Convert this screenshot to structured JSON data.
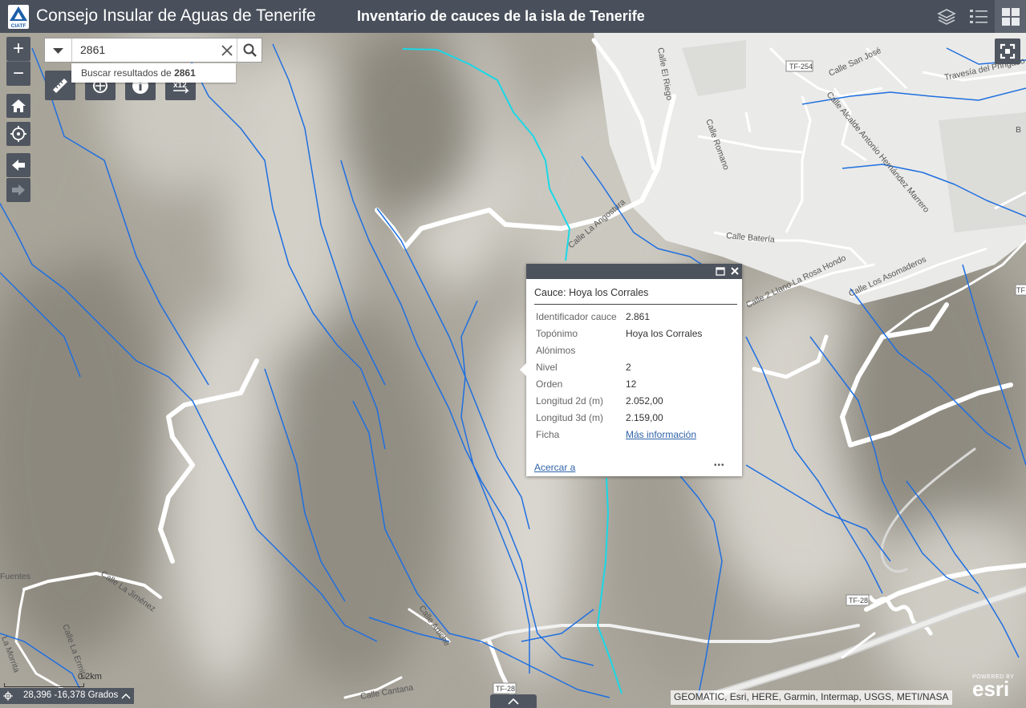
{
  "header": {
    "app_title": "Consejo Insular de Aguas de Tenerife",
    "subtitle": "Inventario de cauces de la isla de Tenerife",
    "logo_text": "CIATF",
    "buttons": [
      "layers-icon",
      "legend-icon",
      "basemap-gallery-icon"
    ]
  },
  "search": {
    "value": "2861",
    "suggestion_prefix": "Buscar resultados de ",
    "suggestion_term": "2861"
  },
  "controls": {
    "zoom_in": "+",
    "zoom_out": "−",
    "measure_tool": "ruler-icon",
    "draw_tool": "draw-icon",
    "info_tool": "info-icon",
    "coordinate_tool": "xy-icon"
  },
  "popup": {
    "title": "Cauce: Hoya los Corrales",
    "fields": [
      {
        "label": "Identificador cauce",
        "value": "2.861"
      },
      {
        "label": "Topónimo",
        "value": "Hoya los Corrales"
      },
      {
        "label": "Alónimos",
        "value": ""
      },
      {
        "label": "Nivel",
        "value": "2"
      },
      {
        "label": "Orden",
        "value": "12"
      },
      {
        "label": "Longitud 2d (m)",
        "value": "2.052,00"
      },
      {
        "label": "Longitud 3d (m)",
        "value": "2.159,00"
      },
      {
        "label": "Ficha",
        "value": "Más información"
      }
    ],
    "zoom_link": "Acercar a",
    "more": "•••"
  },
  "map": {
    "street_labels": [
      "Calle El Riego",
      "TF-254",
      "Calle San José",
      "Travesía del Pringado",
      "Calle Alcalde Antonio Hernández Marrero",
      "Calle Romano",
      "Calle La Angostura",
      "Calle Batería",
      "Calle 2 Llano La Rosa Hondo",
      "Calle Los Asomaderos",
      "Calle La Jiménez",
      "Calle Artiche",
      "TF-28",
      "TF-28",
      "Calle La Ermita",
      "La Morrita",
      "Fuentes",
      "Calle Cantana",
      "TF",
      "B"
    ],
    "scale_label": "0.2km",
    "coordinates": "28,396 -16,378 Grados",
    "attribution": "GEOMATIC, Esri, HERE, Garmin, Intermap, USGS, METI/NASA",
    "esri_powered": "POWERED BY",
    "esri_logo": "esri",
    "colors": {
      "stream": "#1f6fe0",
      "selected_stream": "#19d8e6",
      "road": "#ffffff",
      "header": "#49505b",
      "urban": "#e9e9e7"
    }
  }
}
